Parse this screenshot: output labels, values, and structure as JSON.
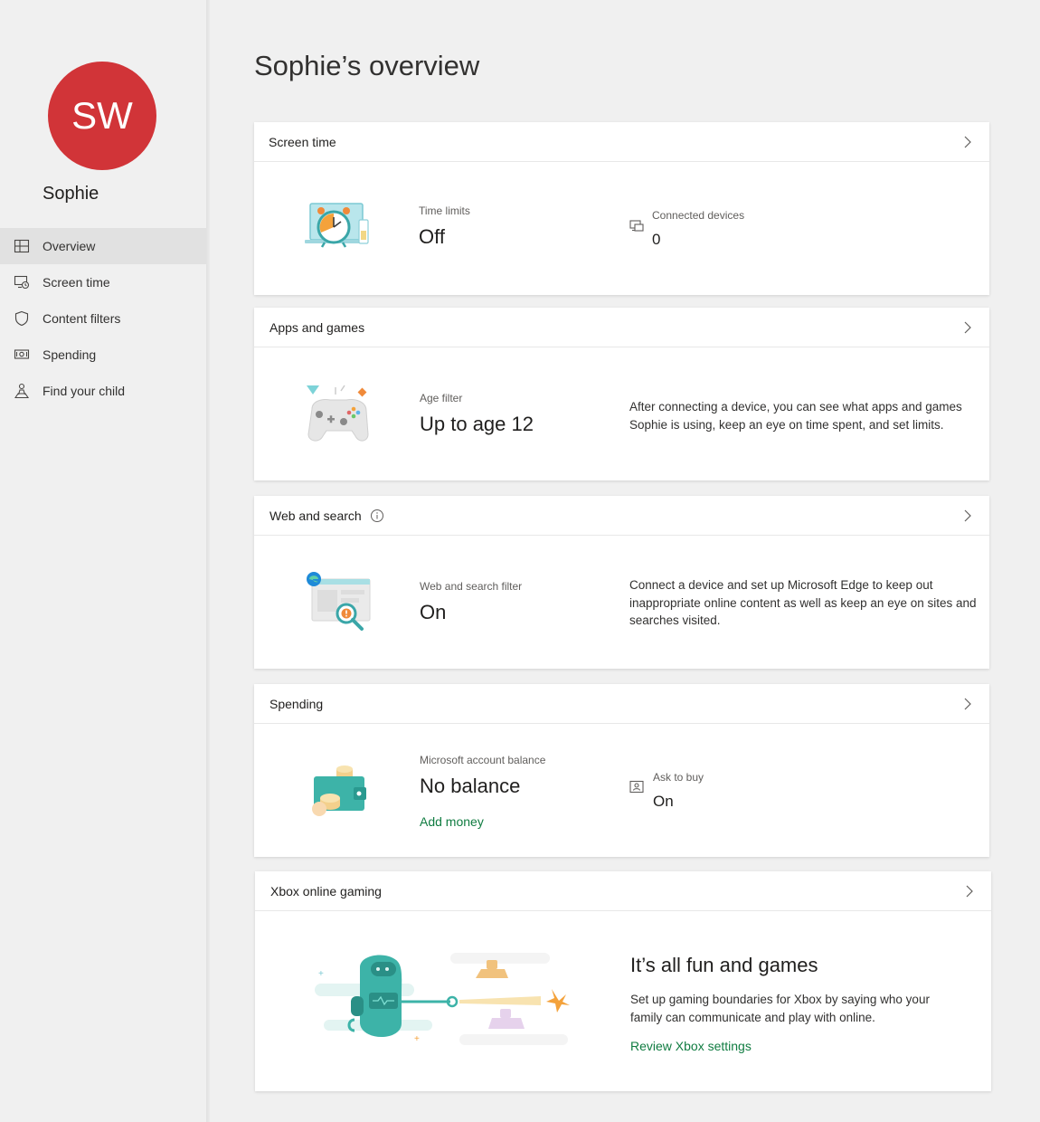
{
  "profile": {
    "initials": "SW",
    "name": "Sophie",
    "avatar_color": "#d13438"
  },
  "nav": {
    "items": [
      {
        "label": "Overview",
        "icon": "overview-icon",
        "active": true
      },
      {
        "label": "Screen time",
        "icon": "screen-time-icon"
      },
      {
        "label": "Content filters",
        "icon": "shield-icon"
      },
      {
        "label": "Spending",
        "icon": "money-icon"
      },
      {
        "label": "Find your child",
        "icon": "person-location-icon"
      }
    ]
  },
  "page": {
    "title": "Sophie’s overview"
  },
  "cards": {
    "screen_time": {
      "title": "Screen time",
      "time_limits_label": "Time limits",
      "time_limits_value": "Off",
      "devices_label": "Connected devices",
      "devices_value": "0"
    },
    "apps_games": {
      "title": "Apps and games",
      "age_filter_label": "Age filter",
      "age_filter_value": "Up to age 12",
      "description": "After connecting a device, you can see what apps and games Sophie is using, keep an eye on time spent, and set limits."
    },
    "web_search": {
      "title": "Web and search",
      "filter_label": "Web and search filter",
      "filter_value": "On",
      "description": "Connect a device and set up Microsoft Edge to keep out inappropriate online content as well as keep an eye on sites and searches visited."
    },
    "spending": {
      "title": "Spending",
      "balance_label": "Microsoft account balance",
      "balance_value": "No balance",
      "add_money": "Add money",
      "ask_label": "Ask to buy",
      "ask_value": "On"
    },
    "xbox": {
      "title": "Xbox online gaming",
      "headline": "It’s all fun and games",
      "description": "Set up gaming boundaries for Xbox by saying who your family can communicate and play with online.",
      "link": "Review Xbox settings"
    }
  },
  "colors": {
    "accent_link": "#107c41",
    "background": "#f0f0f0",
    "nav_active": "#e1e1e1"
  }
}
